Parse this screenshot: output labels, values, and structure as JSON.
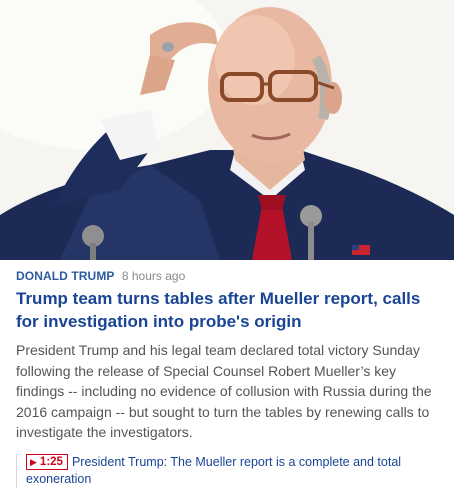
{
  "article": {
    "category": "DONALD TRUMP",
    "timestamp": "8 hours ago",
    "headline": "Trump team turns tables after Mueller report, calls for investigation into probe's origin",
    "summary": "President Trump and his legal team declared total victory Sunday following the release of Special Counsel Robert Mueller’s key findings -- including no evidence of collusion with Russia during the 2016 campaign -- but sought to turn the tables by renewing calls to investigate the investigators."
  },
  "video": {
    "play_icon": "▶",
    "duration": "1:25",
    "title": "President Trump: The Mueller report is a complete and total exoneration"
  },
  "colors": {
    "category": "#2c5aa0",
    "headline": "#1a4594",
    "body_text": "#555555",
    "timestamp": "#8a8a8a",
    "video_badge": "#d0021b"
  }
}
